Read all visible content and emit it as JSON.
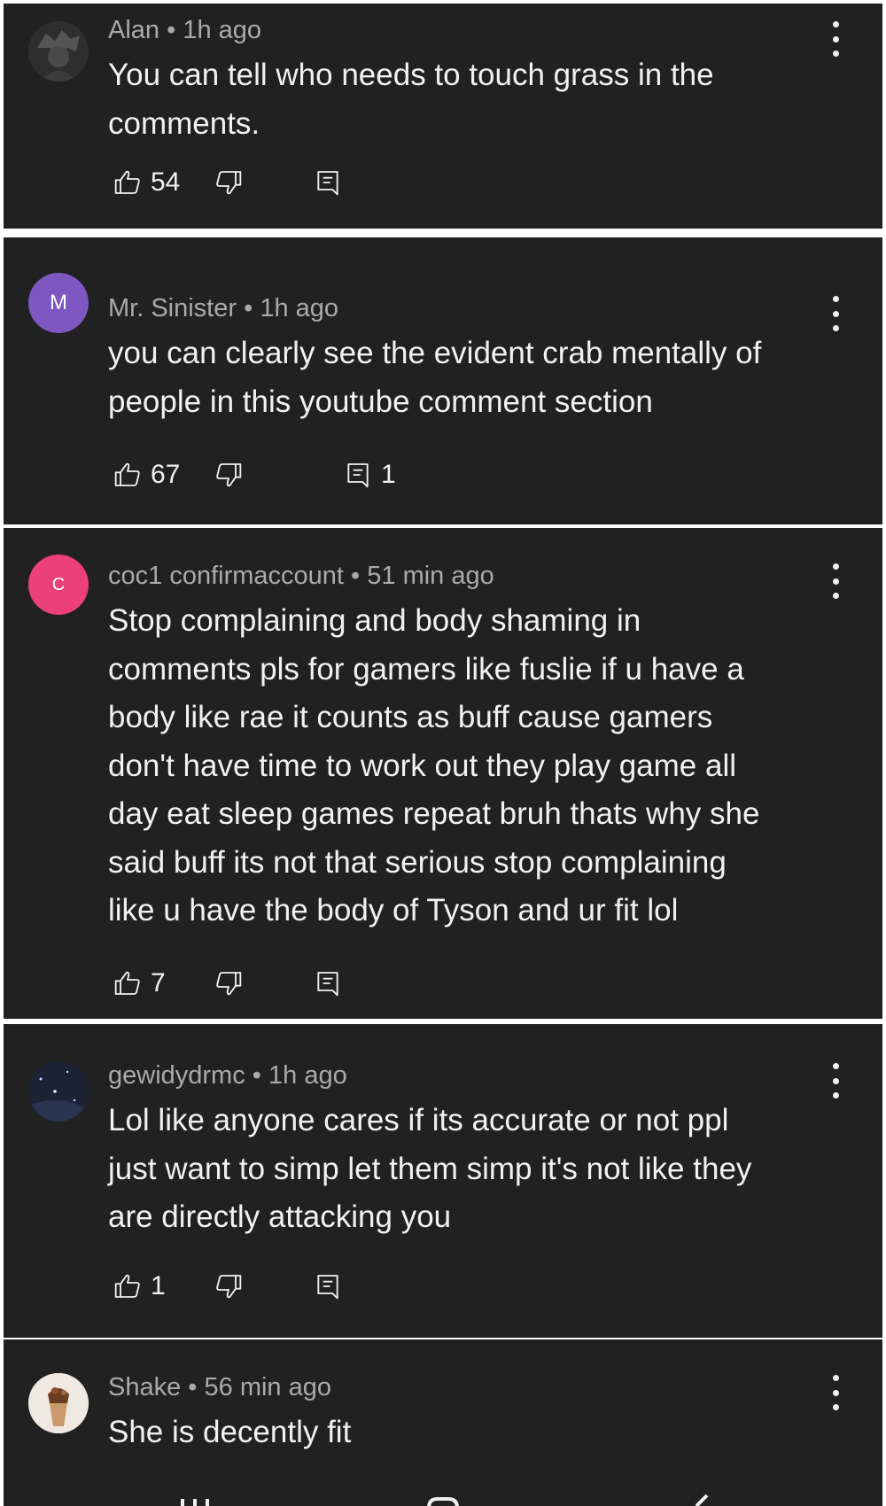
{
  "comments": [
    {
      "author": "Alan",
      "time": "1h ago",
      "text_lines": [
        "You can tell who needs to touch grass in the",
        "comments."
      ],
      "likes": "54",
      "replies": "",
      "avatar_letter": "",
      "avatar_color": "#3a3a3a"
    },
    {
      "author": "Mr. Sinister",
      "time": "1h ago",
      "text_lines": [
        "you can clearly see the evident crab mentally of",
        "people in this youtube comment section"
      ],
      "likes": "67",
      "replies": "1",
      "avatar_letter": "M",
      "avatar_color": "#7e57c2"
    },
    {
      "author": "coc1 confirmaccount",
      "time": "51 min ago",
      "text_lines": [
        "Stop complaining and body shaming in",
        "comments pls for gamers like fuslie if u have a",
        "body like rae it counts as buff cause gamers",
        "don't have time to work out they play game all",
        "day eat sleep games repeat bruh thats why she",
        "said buff its not that serious stop complaining",
        "like u have the body of Tyson and ur fit lol"
      ],
      "likes": "7",
      "replies": "",
      "avatar_letter": "C",
      "avatar_color": "#ec407a"
    },
    {
      "author": "gewidydrmc",
      "time": "1h ago",
      "text_lines": [
        "Lol like anyone cares if its accurate or not ppl",
        "just want to simp let them simp it's not like they",
        "are directly attacking you"
      ],
      "likes": "1",
      "replies": "",
      "avatar_letter": "",
      "avatar_color": "#1b2233"
    },
    {
      "author": "Shake",
      "time": "56 min ago",
      "text_lines": [
        "She is decently fit"
      ],
      "likes": "",
      "replies": "",
      "avatar_letter": "",
      "avatar_color": "#e8e2da"
    }
  ],
  "separator": "•",
  "icons": {
    "like": "thumb-up-icon",
    "dislike": "thumb-down-icon",
    "reply": "comment-icon",
    "more": "more-vert-icon"
  },
  "colors": {
    "background": "#212121",
    "divider": "#ffffff",
    "meta_text": "#aaaaaa",
    "body_text": "#f1f1f1"
  }
}
